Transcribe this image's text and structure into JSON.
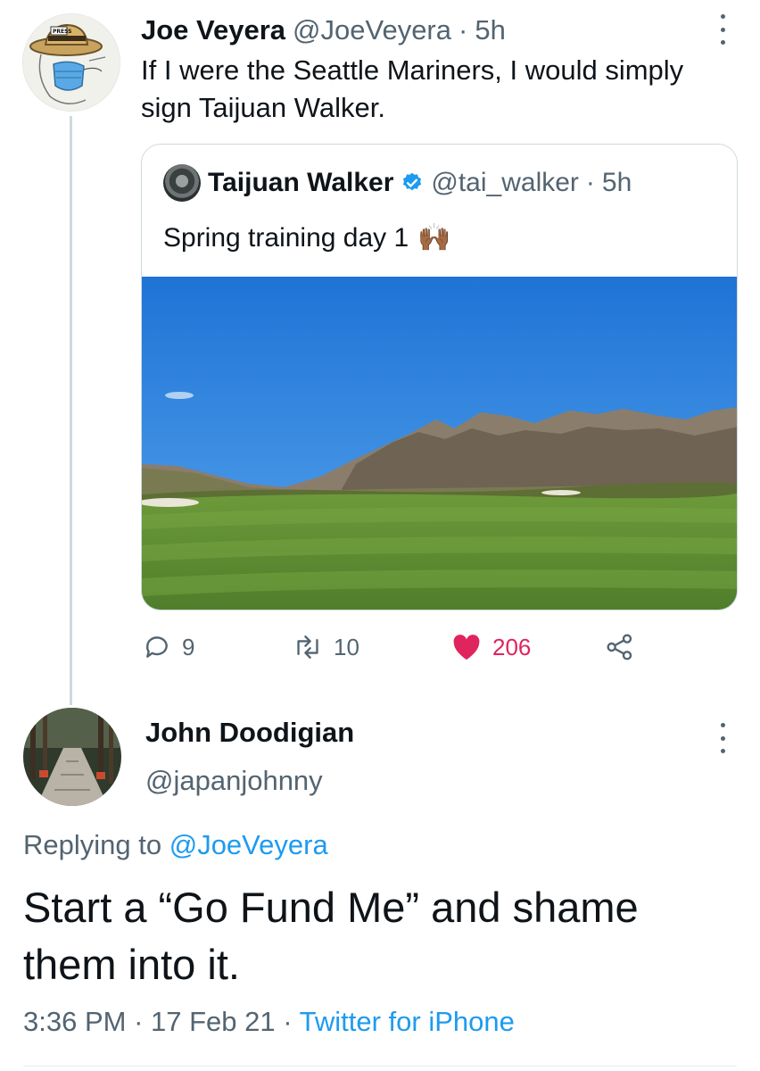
{
  "tweet": {
    "author_name": "Joe Veyera",
    "author_handle": "@JoeVeyera",
    "separator": "·",
    "time": "5h",
    "text": "If I were the Seattle Mariners, I would simply sign Taijuan Walker.",
    "avatar_icon": "press-hat-mask-cartoon-avatar"
  },
  "quoted_tweet": {
    "author_name": "Taijuan Walker",
    "author_handle": "@tai_walker",
    "separator": "·",
    "time": "5h",
    "verified_icon": "verified-badge-icon",
    "text": "Spring training day 1",
    "emoji": "🙌🏾",
    "image_icon": "desert-mountains-golf-course-photo"
  },
  "actions": {
    "reply_count": "9",
    "retweet_count": "10",
    "like_count": "206",
    "like_color": "#e0245e"
  },
  "reply": {
    "author_name": "John Doodigian",
    "author_handle": "@japanjohnny",
    "replying_prefix": "Replying to",
    "replying_to": "@JoeVeyera",
    "text": "Start a “Go Fund Me” and shame them into it.",
    "time": "3:36 PM",
    "separator": "·",
    "date": "17 Feb 21",
    "separator2": "·",
    "source": "Twitter for iPhone",
    "avatar_icon": "stone-path-forest-photo-avatar"
  },
  "colors": {
    "link": "#1d9bf0",
    "muted": "#536471",
    "text": "#0f1419",
    "border": "#cfd9de"
  }
}
